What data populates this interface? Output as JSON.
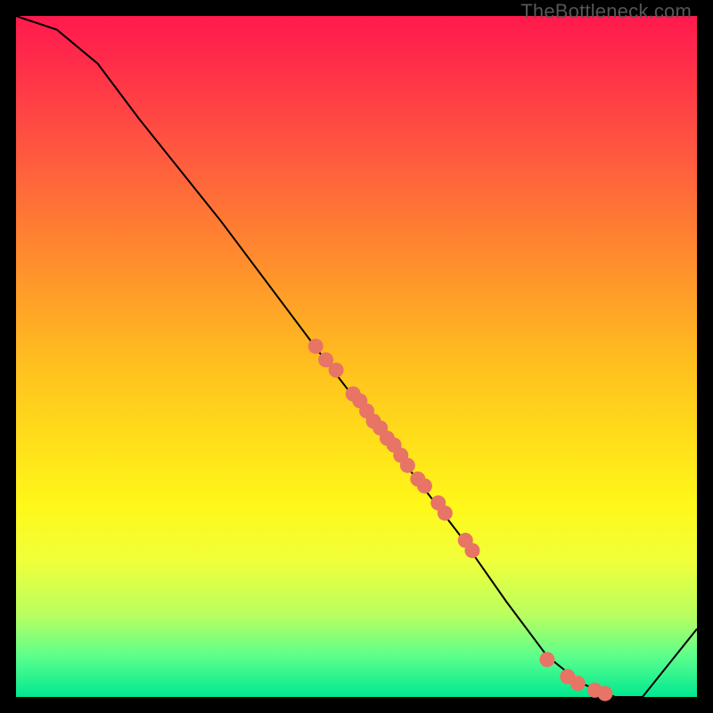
{
  "watermark_text": "TheBottleneck.com",
  "chart_data": {
    "type": "line",
    "title": "",
    "xlabel": "",
    "ylabel": "",
    "xlim": [
      0,
      100
    ],
    "ylim": [
      0,
      100
    ],
    "curve": [
      {
        "x": 0,
        "y": 100
      },
      {
        "x": 6,
        "y": 98
      },
      {
        "x": 12,
        "y": 93
      },
      {
        "x": 18,
        "y": 85
      },
      {
        "x": 30,
        "y": 70
      },
      {
        "x": 45,
        "y": 50
      },
      {
        "x": 55,
        "y": 37
      },
      {
        "x": 65,
        "y": 24
      },
      {
        "x": 72,
        "y": 14
      },
      {
        "x": 78,
        "y": 6
      },
      {
        "x": 83,
        "y": 2
      },
      {
        "x": 88,
        "y": 0
      },
      {
        "x": 92,
        "y": 0
      },
      {
        "x": 100,
        "y": 10
      }
    ],
    "scatter": [
      {
        "x": 44,
        "y": 51.5
      },
      {
        "x": 45.5,
        "y": 49.5
      },
      {
        "x": 47,
        "y": 48
      },
      {
        "x": 49.5,
        "y": 44.5
      },
      {
        "x": 50.5,
        "y": 43.5
      },
      {
        "x": 51.5,
        "y": 42
      },
      {
        "x": 52.5,
        "y": 40.5
      },
      {
        "x": 53.5,
        "y": 39.5
      },
      {
        "x": 54.5,
        "y": 38
      },
      {
        "x": 55.5,
        "y": 37
      },
      {
        "x": 56.5,
        "y": 35.5
      },
      {
        "x": 57.5,
        "y": 34
      },
      {
        "x": 59,
        "y": 32
      },
      {
        "x": 60,
        "y": 31
      },
      {
        "x": 62,
        "y": 28.5
      },
      {
        "x": 63,
        "y": 27
      },
      {
        "x": 66,
        "y": 23
      },
      {
        "x": 67,
        "y": 21.5
      },
      {
        "x": 78,
        "y": 5.5
      },
      {
        "x": 81,
        "y": 3
      },
      {
        "x": 82.5,
        "y": 2
      },
      {
        "x": 85,
        "y": 1
      },
      {
        "x": 86.5,
        "y": 0.5
      }
    ],
    "dot_color": "#e77464",
    "gradient_stops": [
      {
        "pos": 0,
        "color": "#ff1a4d"
      },
      {
        "pos": 50,
        "color": "#ffe31a"
      },
      {
        "pos": 100,
        "color": "#00e890"
      }
    ]
  }
}
